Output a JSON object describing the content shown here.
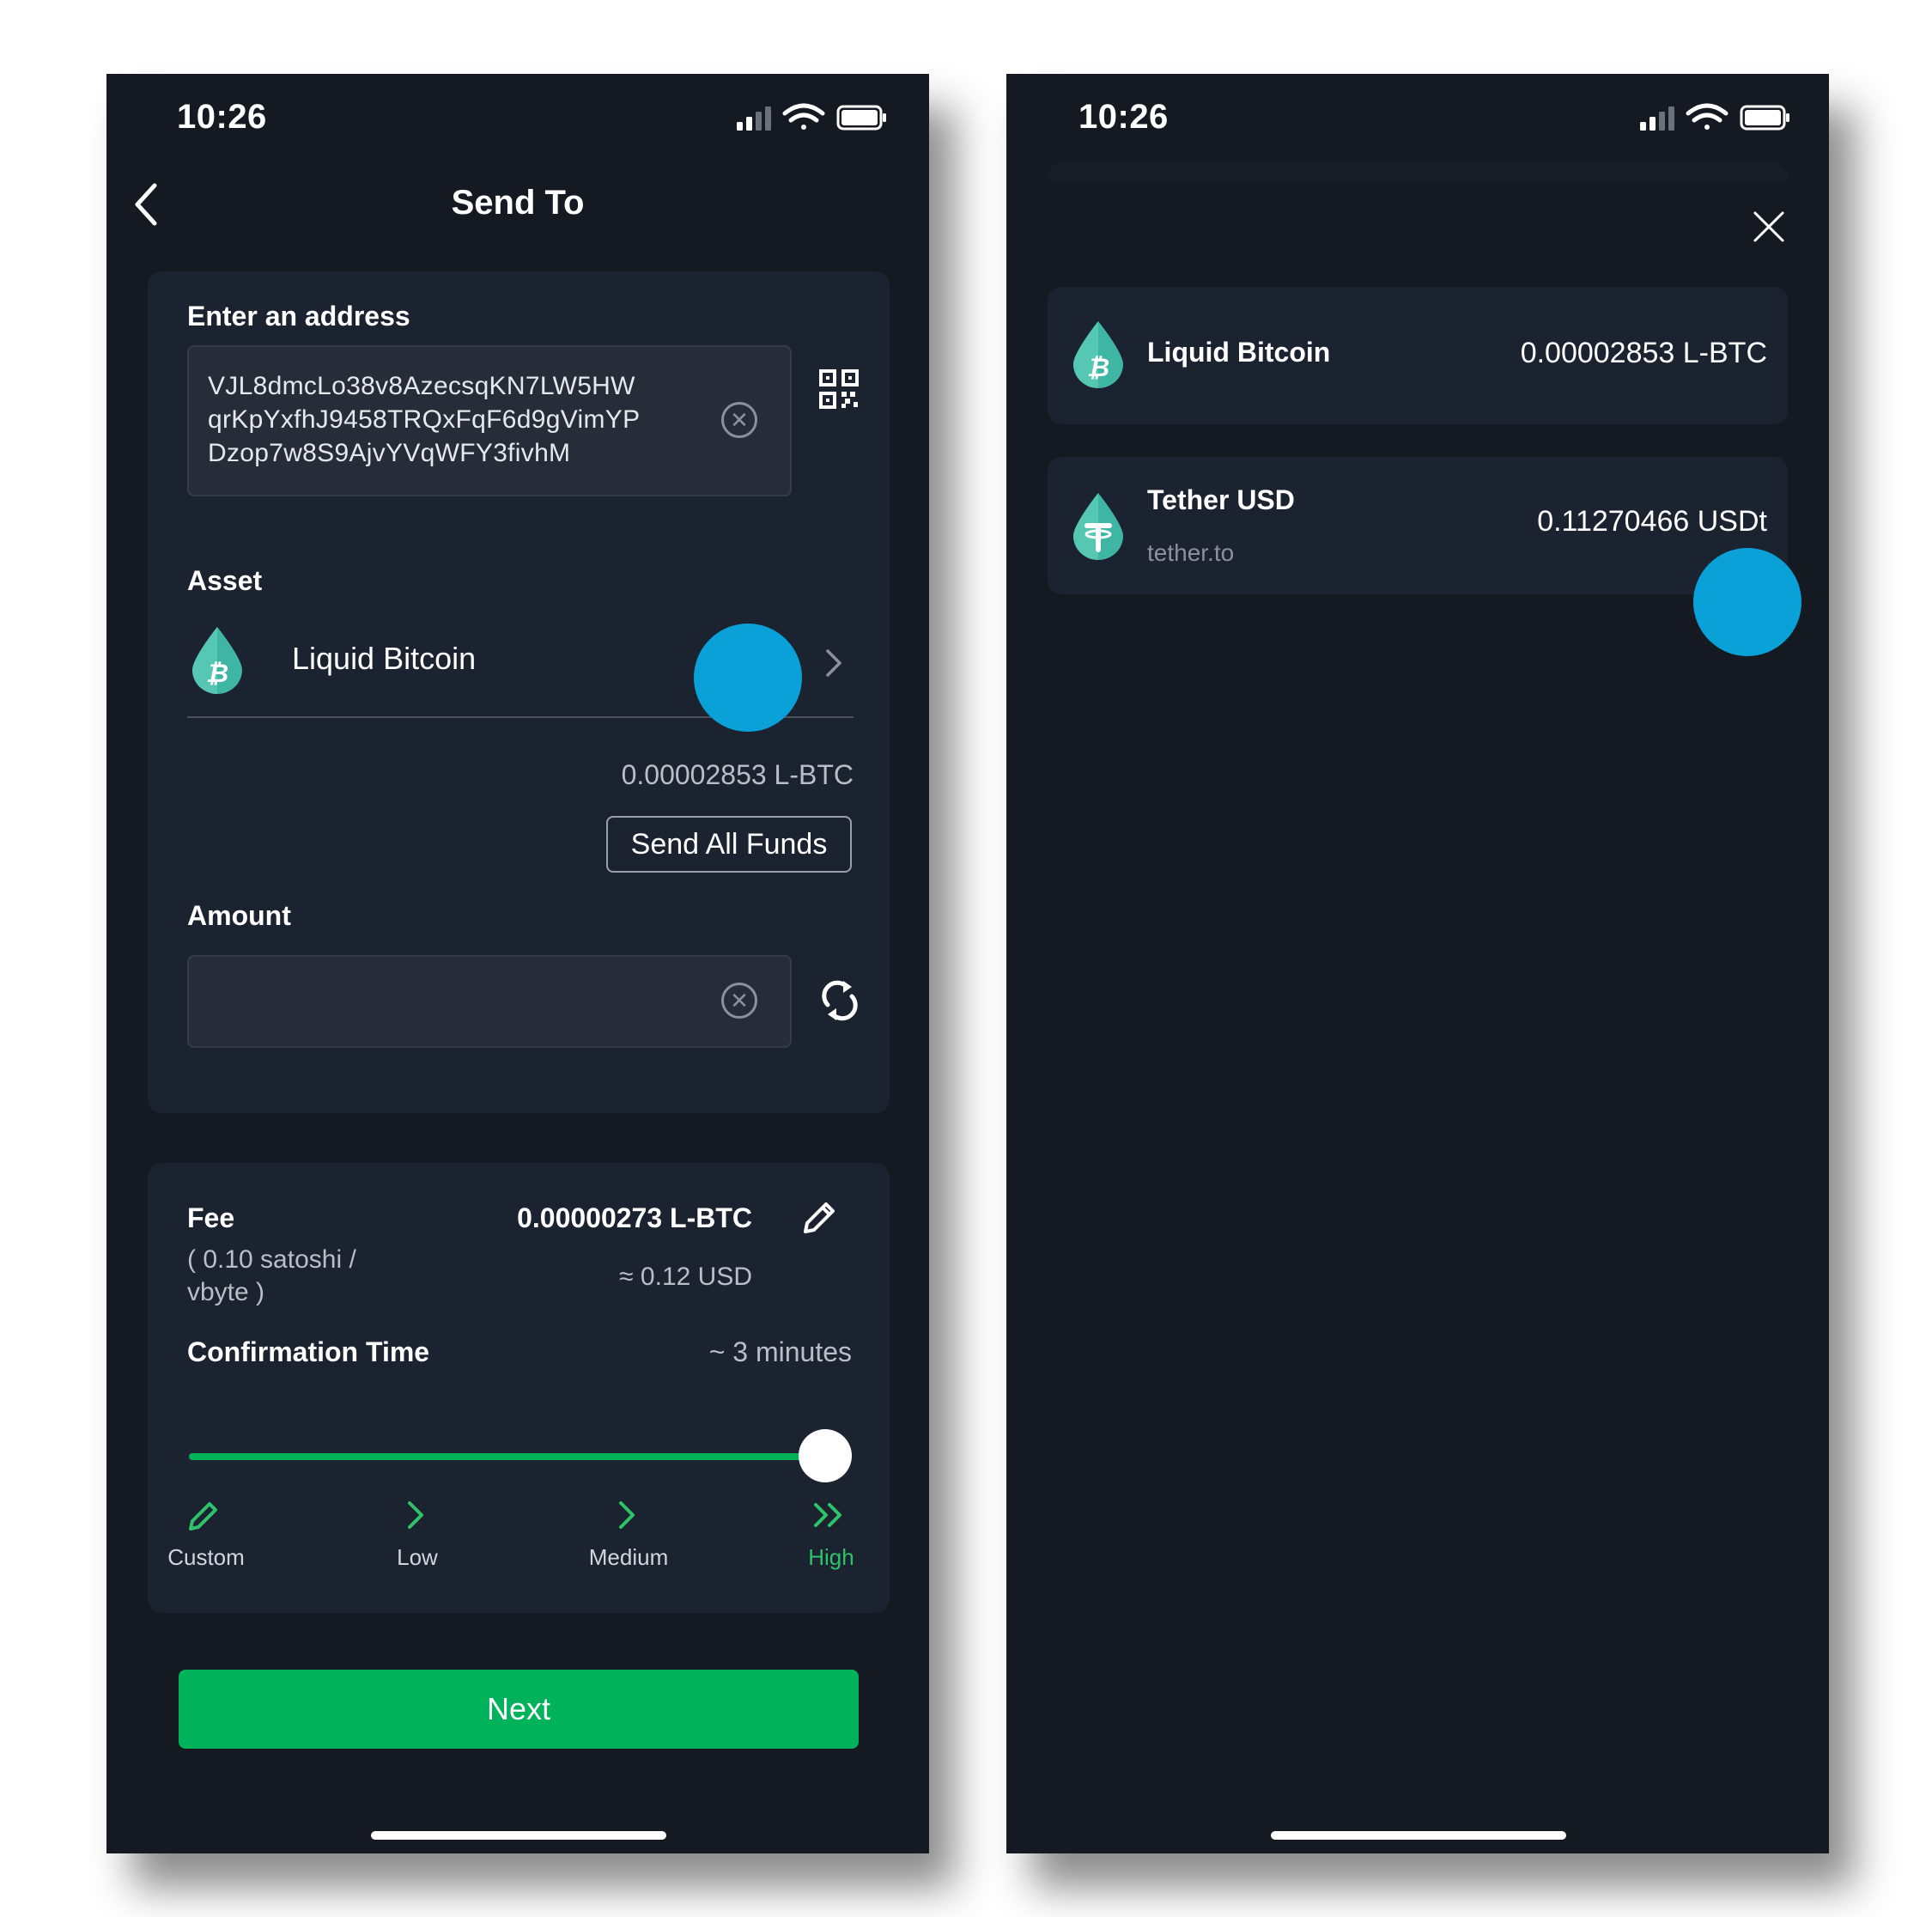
{
  "colors": {
    "bg": "#141922",
    "card": "#1c2330",
    "accent_green": "#00b35a",
    "touch": "#0aa0d8"
  },
  "status_bar": {
    "time": "10:26"
  },
  "send_screen": {
    "title": "Send To",
    "address_label": "Enter an address",
    "address_lines": [
      "VJL8dmcLo38v8AzecsqKN7LW5HW",
      "qrKpYxfhJ9458TRQxFqF6d9gVimYP",
      "Dzop7w8S9AjvYVqWFY3fivhM"
    ],
    "asset_label": "Asset",
    "asset_name": "Liquid Bitcoin",
    "balance": "0.00002853 L-BTC",
    "send_all_label": "Send All Funds",
    "amount_label": "Amount",
    "amount_value": "",
    "fee_label": "Fee",
    "fee_rate_line1": "( 0.10 satoshi /",
    "fee_rate_line2": "vbyte )",
    "fee_amount": "0.00000273 L-BTC",
    "fee_usd": "≈ 0.12 USD",
    "confirmation_label": "Confirmation Time",
    "confirmation_value": "~ 3 minutes",
    "slider_level": 1.0,
    "speeds": [
      "Custom",
      "Low",
      "Medium",
      "High"
    ],
    "selected_speed": "High",
    "next_label": "Next"
  },
  "asset_picker": {
    "assets": [
      {
        "name": "Liquid Bitcoin",
        "balance": "0.00002853 L-BTC",
        "icon": "liquid-bitcoin-icon"
      },
      {
        "name": "Tether USD",
        "domain": "tether.to",
        "balance": "0.11270466 USDt",
        "icon": "tether-icon"
      }
    ]
  }
}
